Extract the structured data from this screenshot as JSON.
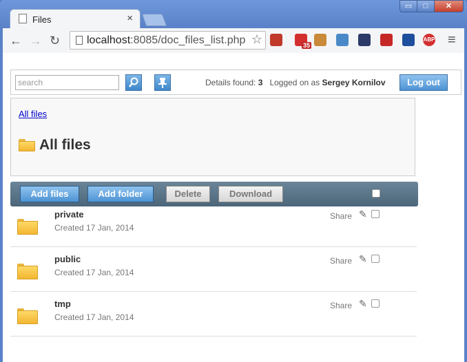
{
  "browser": {
    "tab_title": "Files",
    "tab_close": "×",
    "url_host": "localhost",
    "url_rest": ":8085/doc_files_list.php",
    "window_controls": {
      "minimize": "▭",
      "maximize": "□",
      "close": "✕"
    }
  },
  "extensions": [
    {
      "name": "bookmark-ext-icon",
      "color": "#c0392b"
    },
    {
      "name": "badge-35-ext-icon",
      "color": "#d32f2f",
      "badge": "35"
    },
    {
      "name": "cookie-ext-icon",
      "color": "#c98b3a"
    },
    {
      "name": "window-ext-icon",
      "color": "#4a89c8"
    },
    {
      "name": "gauge-ext-icon",
      "color": "#2b3a67"
    },
    {
      "name": "stop-ext-icon",
      "color": "#c62828"
    },
    {
      "name": "info-ext-icon",
      "color": "#1e4f9c"
    },
    {
      "name": "adblock-ext-icon",
      "color": "#d32f2f",
      "label": "ABP"
    }
  ],
  "topbar": {
    "search_placeholder": "search",
    "details_label": "Details found:",
    "details_count": "3",
    "logged_label": "Logged on as",
    "user_name": "Sergey Kornilov",
    "logout_label": "Log out"
  },
  "breadcrumb": {
    "link": "All files",
    "title": "All files"
  },
  "actions": {
    "add_files": "Add files",
    "add_folder": "Add folder",
    "delete": "Delete",
    "download": "Download"
  },
  "files": [
    {
      "name": "private",
      "created": "Created 17 Jan, 2014",
      "share": "Share"
    },
    {
      "name": "public",
      "created": "Created 17 Jan, 2014",
      "share": "Share"
    },
    {
      "name": "tmp",
      "created": "Created 17 Jan, 2014",
      "share": "Share"
    }
  ],
  "colors": {
    "accent": "#4d93d3",
    "action_bar": "#4c6579",
    "folder": "#f2b632",
    "window_frame": "#5a82c8"
  }
}
